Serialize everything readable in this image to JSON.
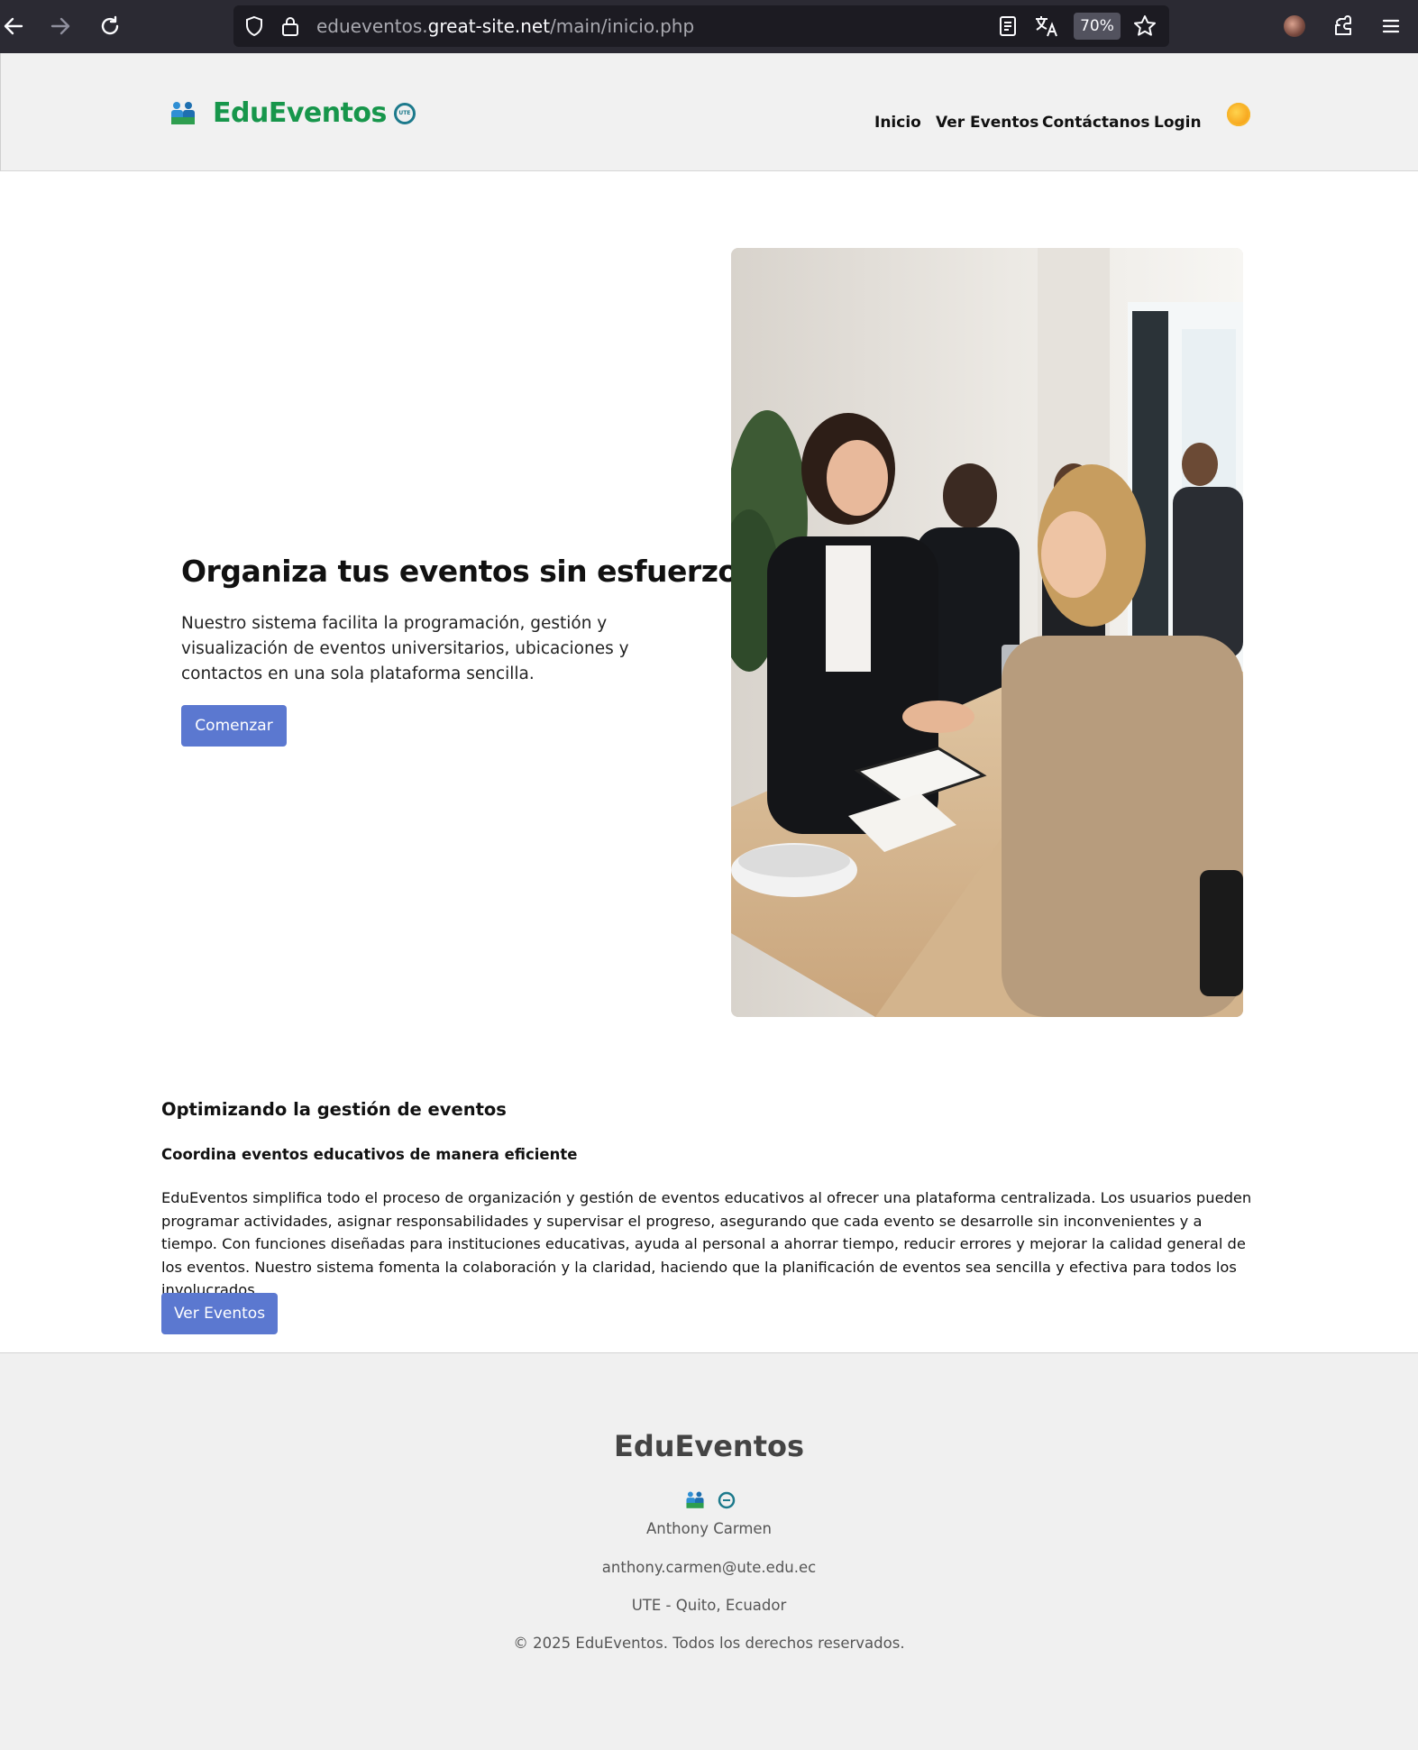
{
  "browser": {
    "url_prefix": "edueventos.",
    "url_host": "great-site.net",
    "url_path": "/main/inicio.php",
    "zoom": "70%"
  },
  "header": {
    "brand": "EduEventos",
    "badge_text": "UTE",
    "nav": [
      "Inicio",
      "Ver Eventos",
      "Contáctanos",
      "Login"
    ],
    "theme_icon": "sun-icon"
  },
  "hero": {
    "title": "Organiza tus eventos sin esfuerzo",
    "text": "Nuestro sistema facilita la programación, gestión y visualización de eventos universitarios, ubicaciones y contactos en una sola plataforma sencilla.",
    "cta": "Comenzar"
  },
  "section": {
    "title": "Optimizando la gestión de eventos",
    "subtitle": "Coordina eventos educativos de manera eficiente",
    "body": "EduEventos simplifica todo el proceso de organización y gestión de eventos educativos al ofrecer una plataforma centralizada. Los usuarios pueden programar actividades, asignar responsabilidades y supervisar el progreso, asegurando que cada evento se desarrolle sin inconvenientes y a tiempo. Con funciones diseñadas para instituciones educativas, ayuda al personal a ahorrar tiempo, reducir errores y mejorar la calidad general de los eventos. Nuestro sistema fomenta la colaboración y la claridad, haciendo que la planificación de eventos sea sencilla y efectiva para todos los involucrados.",
    "cta": "Ver Eventos"
  },
  "footer": {
    "brand": "EduEventos",
    "name": "Anthony Carmen",
    "email": "anthony.carmen@ute.edu.ec",
    "location": "UTE - Quito, Ecuador",
    "copyright": "© 2025 EduEventos. Todos los derechos reservados."
  },
  "colors": {
    "brand_green": "#17964b",
    "button_blue": "#5b78d0",
    "header_bg": "#f1f1f1"
  }
}
